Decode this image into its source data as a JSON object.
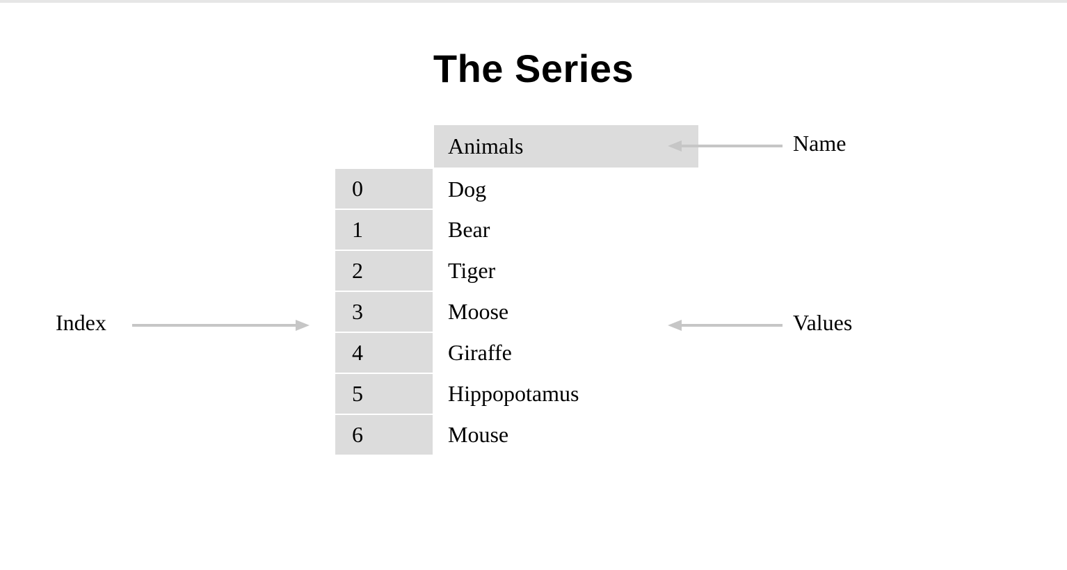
{
  "title": "The Series",
  "series": {
    "name": "Animals",
    "index": [
      0,
      1,
      2,
      3,
      4,
      5,
      6
    ],
    "values": [
      "Dog",
      "Bear",
      "Tiger",
      "Moose",
      "Giraffe",
      "Hippopotamus",
      "Mouse"
    ]
  },
  "labels": {
    "index": "Index",
    "name": "Name",
    "values": "Values"
  },
  "colors": {
    "header_bg": "#dcdcdc",
    "arrow": "#c6c6c6"
  }
}
